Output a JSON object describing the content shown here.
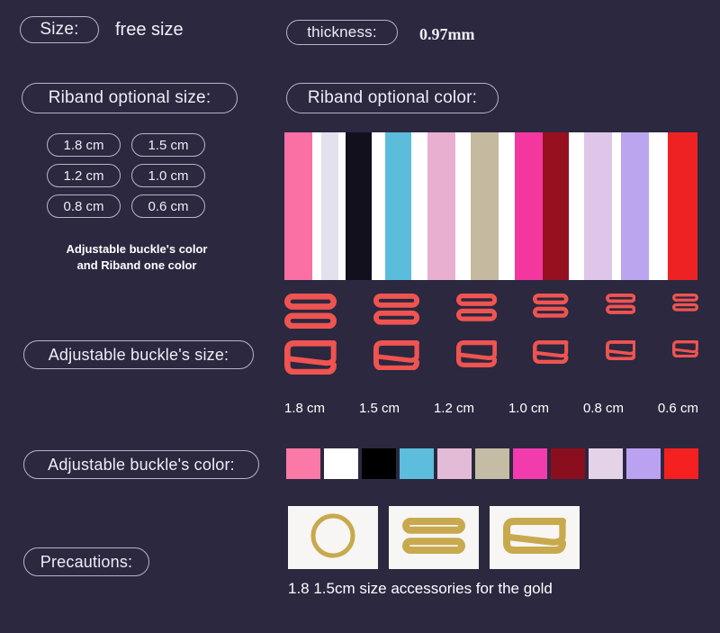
{
  "theme": {
    "background": "#2b2840",
    "pill_border": "#b9b4c9",
    "text": "#f2eff7",
    "buckle_color": "#ef5450",
    "gold": "#c9a94e"
  },
  "header": {
    "size_label": "Size:",
    "size_value": "free size",
    "thickness_label": "thickness:",
    "thickness_value": "0.97mm"
  },
  "riband": {
    "size_section_label": "Riband optional size:",
    "color_section_label": "Riband optional color:",
    "size_options": [
      "1.8 cm",
      "1.5 cm",
      "1.2 cm",
      "1.0 cm",
      "0.8 cm",
      "0.6 cm"
    ],
    "note_line1": "Adjustable buckle's color",
    "note_line2": "and Riband one color",
    "color_bands": [
      {
        "name": "pink",
        "color": "#fa6fa4",
        "width": 30
      },
      {
        "name": "white",
        "color": "#ffffff",
        "width": 10
      },
      {
        "name": "lavender-white",
        "color": "#e2e1ed",
        "width": 18
      },
      {
        "name": "white",
        "color": "#fdfdfd",
        "width": 8
      },
      {
        "name": "black",
        "color": "#11101c",
        "width": 28
      },
      {
        "name": "white",
        "color": "#ffffff",
        "width": 14
      },
      {
        "name": "sky-blue",
        "color": "#5cbcdb",
        "width": 28
      },
      {
        "name": "white",
        "color": "#ffffff",
        "width": 18
      },
      {
        "name": "pink-lilac",
        "color": "#e8afd0",
        "width": 30
      },
      {
        "name": "white",
        "color": "#ffffff",
        "width": 16
      },
      {
        "name": "tan",
        "color": "#c5b9a0",
        "width": 30
      },
      {
        "name": "white",
        "color": "#ffffff",
        "width": 18
      },
      {
        "name": "magenta",
        "color": "#f4379f",
        "width": 30
      },
      {
        "name": "dark-red",
        "color": "#96101f",
        "width": 28
      },
      {
        "name": "white",
        "color": "#ffffff",
        "width": 16
      },
      {
        "name": "lilac",
        "color": "#dfc6e8",
        "width": 30
      },
      {
        "name": "white",
        "color": "#ffffff",
        "width": 10
      },
      {
        "name": "light-purple",
        "color": "#bba5ef",
        "width": 30
      },
      {
        "name": "white",
        "color": "#ffffff",
        "width": 20
      },
      {
        "name": "red",
        "color": "#ee2222",
        "width": 32
      }
    ]
  },
  "buckles": {
    "size_section_label": "Adjustable buckle's size:",
    "color_section_label": "Adjustable buckle's color:",
    "sizes": [
      "1.8 cm",
      "1.5 cm",
      "1.2 cm",
      "1.0 cm",
      "0.8 cm",
      "0.6 cm"
    ],
    "scales": [
      1.0,
      0.88,
      0.78,
      0.68,
      0.58,
      0.5
    ],
    "shapes": [
      "slider-8-icon",
      "hook-g-icon"
    ],
    "colors": [
      {
        "name": "pink",
        "color": "#fa79a6"
      },
      {
        "name": "white",
        "color": "#ffffff"
      },
      {
        "name": "black",
        "color": "#000000"
      },
      {
        "name": "sky-blue",
        "color": "#5cbddd"
      },
      {
        "name": "pink-lilac",
        "color": "#e4bbd6"
      },
      {
        "name": "tan",
        "color": "#c4bca4"
      },
      {
        "name": "magenta",
        "color": "#f23cae"
      },
      {
        "name": "dark-red",
        "color": "#8b0e1e"
      },
      {
        "name": "light-lilac",
        "color": "#e3d2e8"
      },
      {
        "name": "purple",
        "color": "#bba2f0"
      },
      {
        "name": "red",
        "color": "#f52020"
      }
    ]
  },
  "precautions": {
    "label": "Precautions:",
    "caption": "1.8 1.5cm size accessories for the gold",
    "items": [
      "o-ring-icon",
      "slider-8-icon",
      "hook-g-icon"
    ]
  }
}
